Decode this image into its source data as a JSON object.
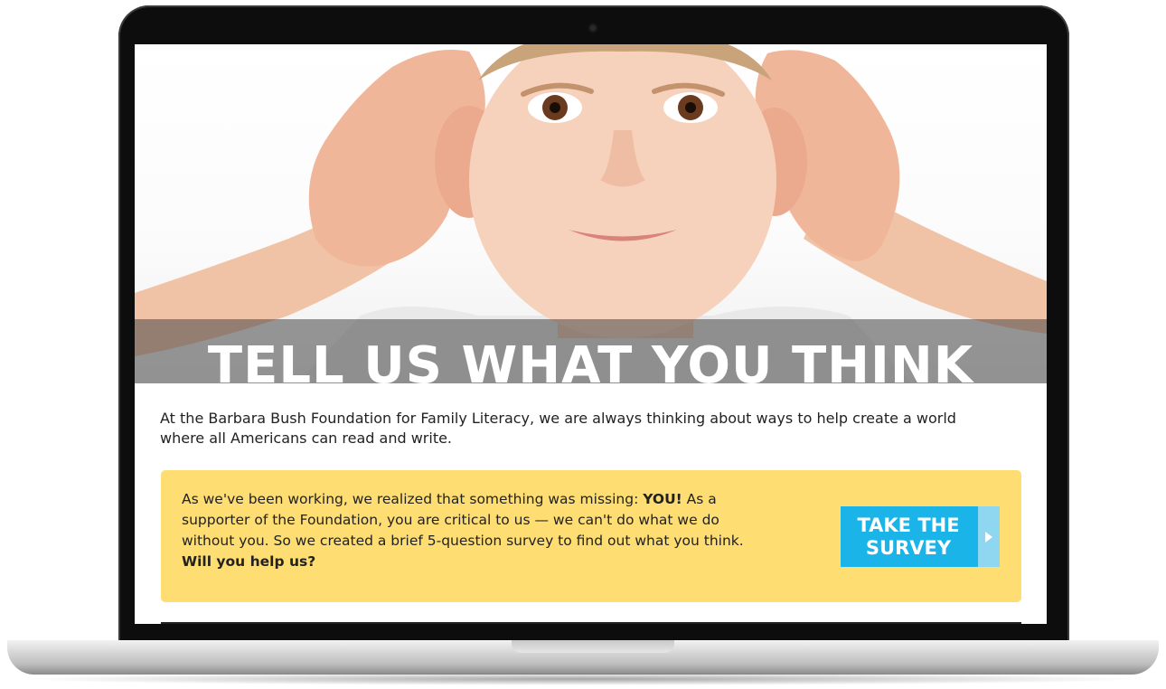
{
  "hero": {
    "title": "TELL US WHAT YOU THINK",
    "image_alt": "child-cupping-ears"
  },
  "intro": {
    "text": "At the Barbara Bush Foundation for Family Literacy, we are always thinking about ways to help create a world where all Americans can read and write."
  },
  "callout": {
    "text_before": "As we've been working, we realized that something was missing: ",
    "emphasis": "YOU!",
    "text_after": " As a supporter of the Foundation, you are critical to us — we can't do what we do without you. So we created a brief 5-question survey to find out what you think.",
    "question": "Will you help us?",
    "button_line1": "TAKE THE",
    "button_line2": "SURVEY"
  },
  "colors": {
    "callout_bg": "#fedd73",
    "button_bg": "#1ab4e8",
    "button_arrow_bg": "#8fd6f1",
    "text": "#222222"
  }
}
